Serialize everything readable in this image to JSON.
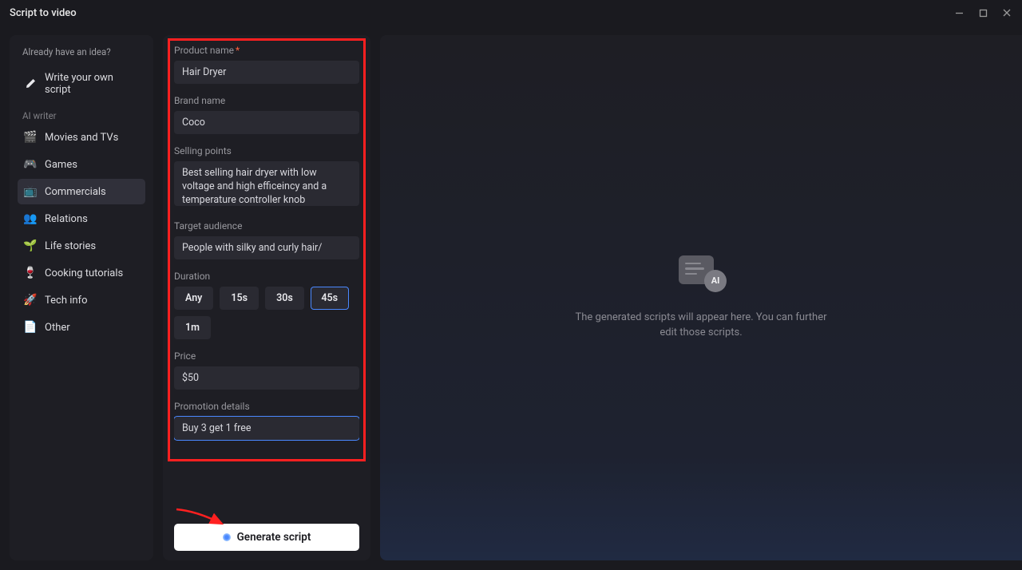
{
  "window": {
    "title": "Script to video"
  },
  "sidebar": {
    "idea_header": "Already have an idea?",
    "write_own": "Write your own script",
    "ai_writer_label": "AI writer",
    "items": [
      {
        "label": "Movies and TVs",
        "icon": "🎬",
        "name": "movies-tvs"
      },
      {
        "label": "Games",
        "icon": "🎮",
        "name": "games"
      },
      {
        "label": "Commercials",
        "icon": "📺",
        "name": "commercials"
      },
      {
        "label": "Relations",
        "icon": "👥",
        "name": "relations"
      },
      {
        "label": "Life stories",
        "icon": "🌱",
        "name": "life-stories"
      },
      {
        "label": "Cooking tutorials",
        "icon": "🍷",
        "name": "cooking-tutorials"
      },
      {
        "label": "Tech info",
        "icon": "🚀",
        "name": "tech-info"
      },
      {
        "label": "Other",
        "icon": "📄",
        "name": "other"
      }
    ]
  },
  "form": {
    "product_name_label": "Product name",
    "product_name_value": "Hair Dryer",
    "brand_name_label": "Brand name",
    "brand_name_value": "Coco",
    "selling_points_label": "Selling points",
    "selling_points_value": "Best selling hair dryer with low voltage and high efficeincy and a temperature controller knob",
    "target_audience_label": "Target audience",
    "target_audience_value": "People with silky and curly hair/",
    "duration_label": "Duration",
    "duration_options": [
      "Any",
      "15s",
      "30s",
      "45s",
      "1m"
    ],
    "duration_selected": "45s",
    "price_label": "Price",
    "price_value": "$50",
    "promotion_details_label": "Promotion details",
    "promotion_details_value": "Buy 3 get 1 free",
    "generate_button": "Generate script"
  },
  "preview": {
    "ai_badge": "AI",
    "empty_text": "The generated scripts will appear here. You can further edit those scripts."
  },
  "annotations": {
    "highlight_box": true,
    "arrow_to_generate": true
  },
  "colors": {
    "accent": "#4a88ff",
    "highlight": "#ff2020",
    "bg": "#1a1a1f",
    "panel": "#1e1e24",
    "input": "#2a2a32"
  }
}
